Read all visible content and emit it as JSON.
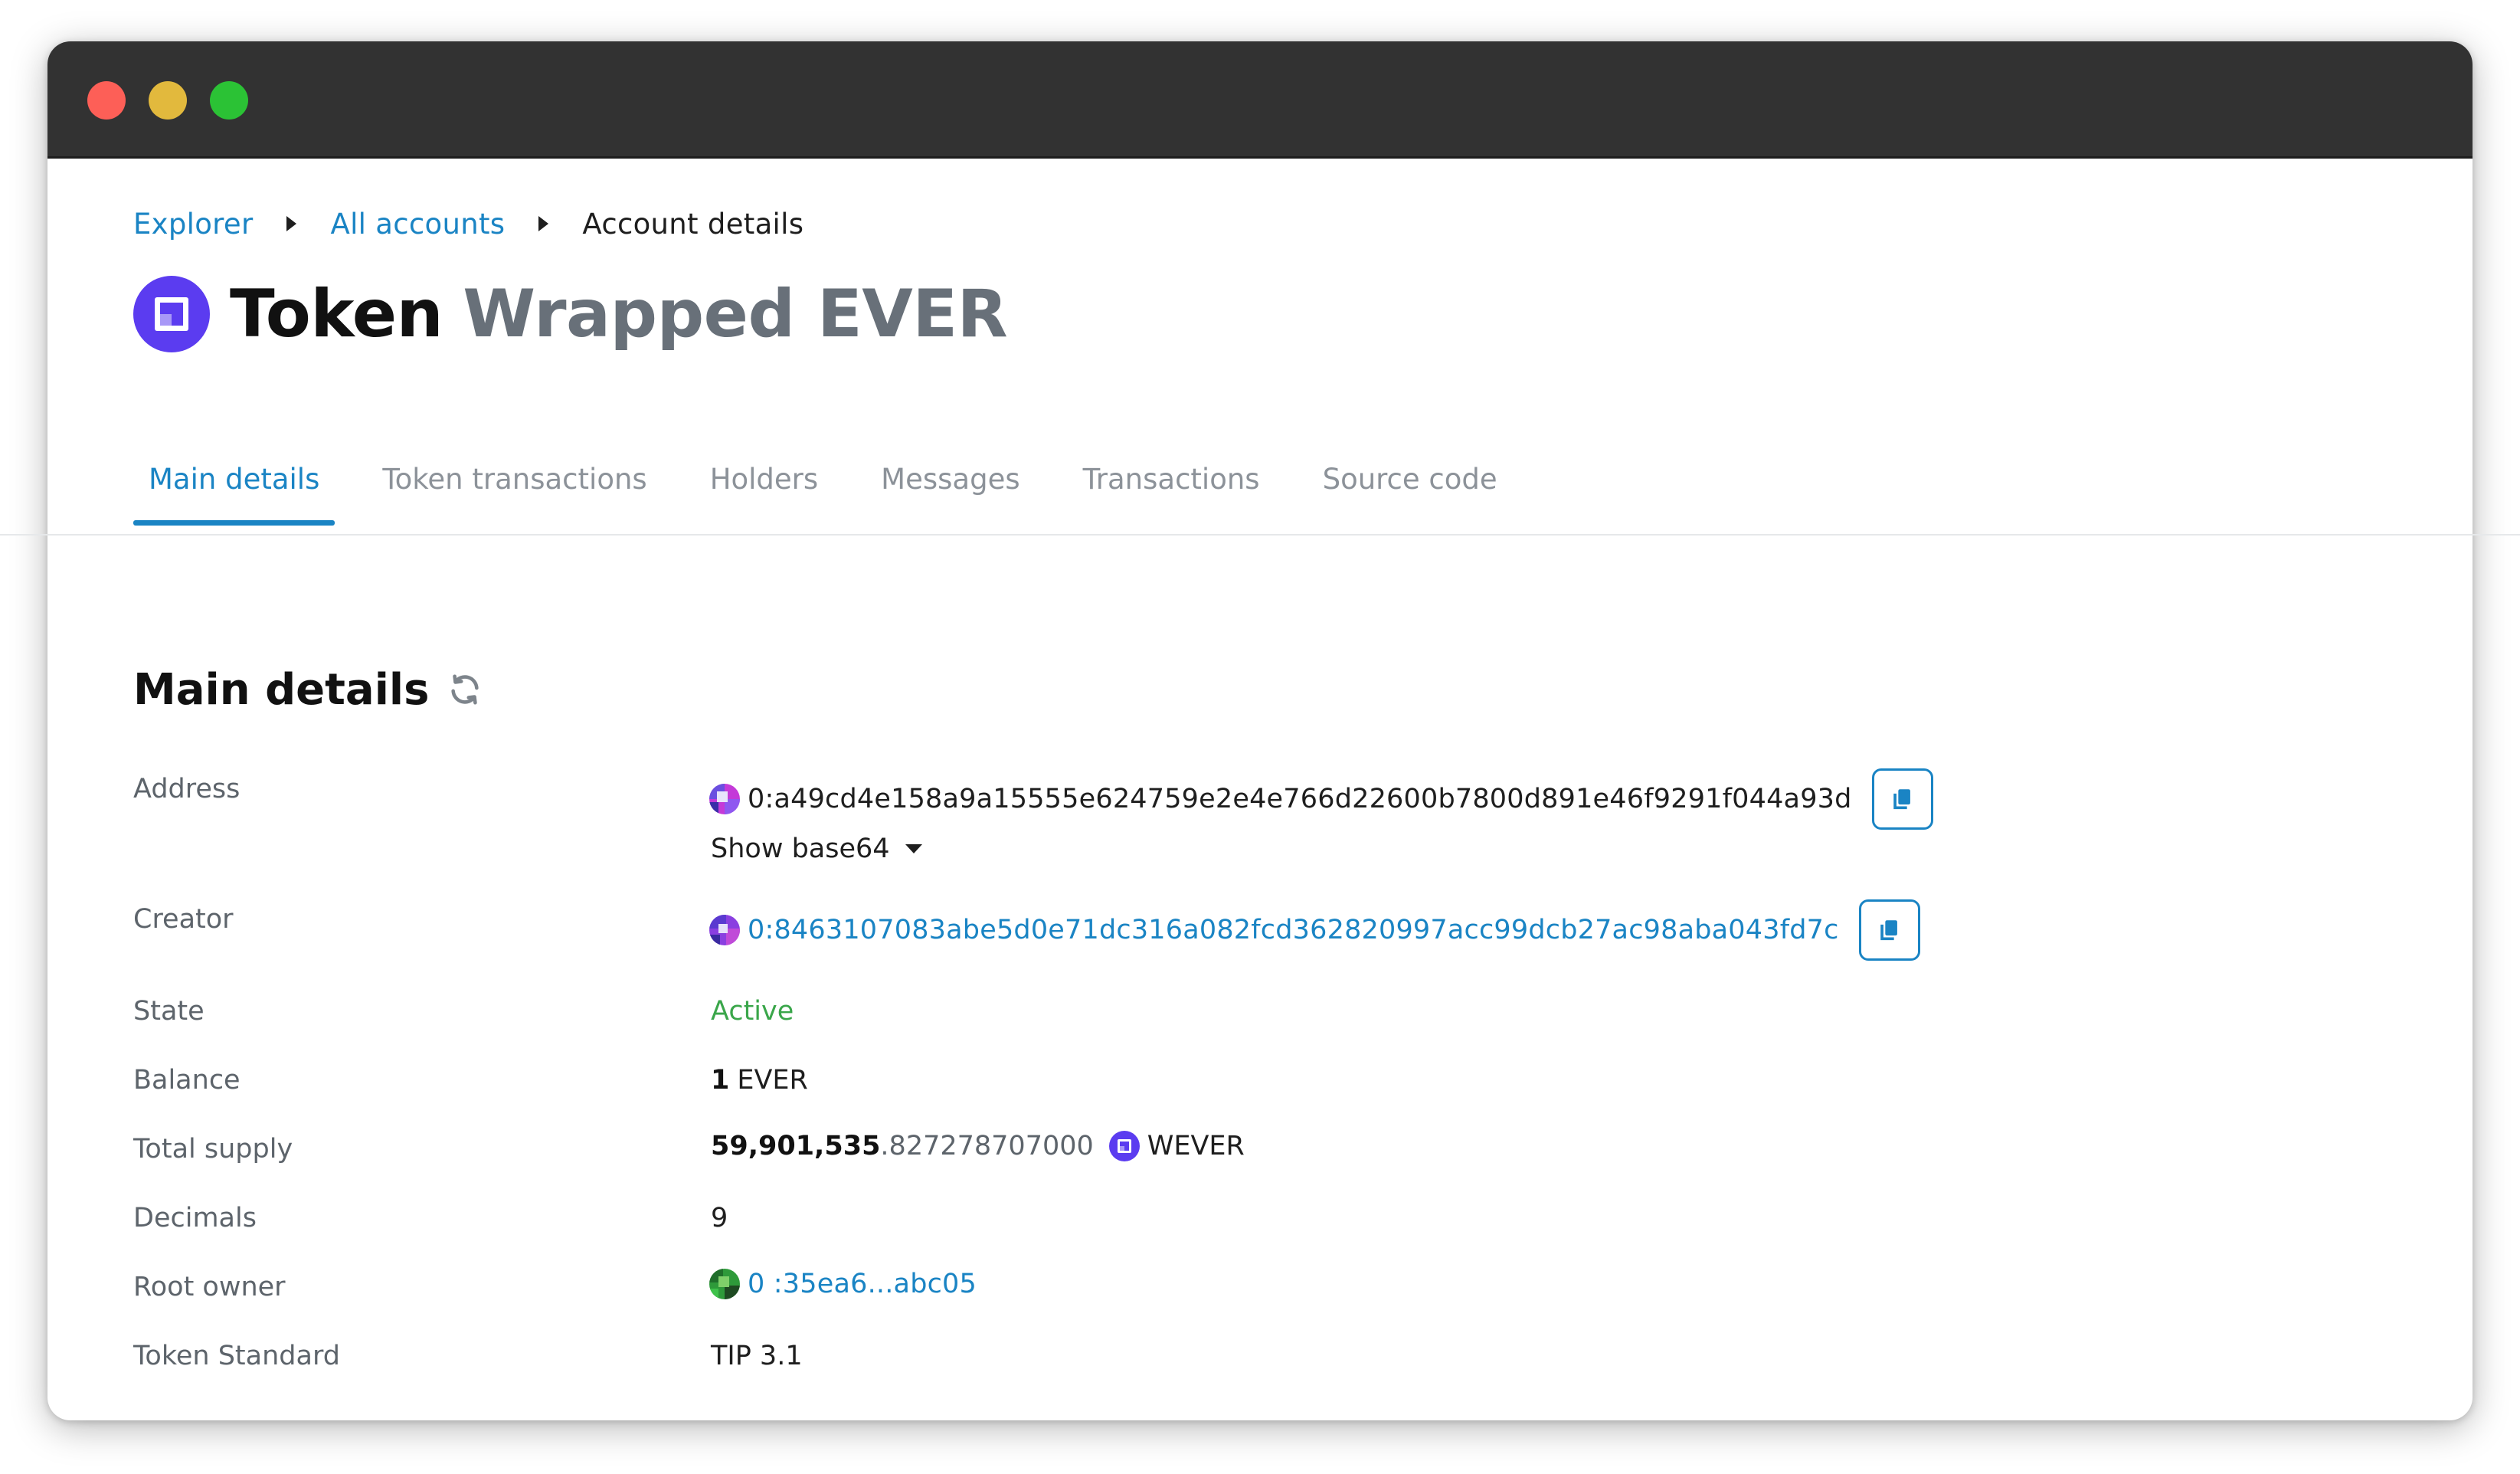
{
  "breadcrumb": {
    "explorer": "Explorer",
    "all_accounts": "All accounts",
    "current": "Account details"
  },
  "header": {
    "prefix": "Token",
    "name": "Wrapped EVER"
  },
  "tabs": [
    {
      "label": "Main details",
      "active": true
    },
    {
      "label": "Token transactions"
    },
    {
      "label": "Holders"
    },
    {
      "label": "Messages"
    },
    {
      "label": "Transactions"
    },
    {
      "label": "Source code"
    }
  ],
  "section": {
    "title": "Main details"
  },
  "details": {
    "address": {
      "label": "Address",
      "value": "0:a49cd4e158a9a15555e624759e2e4e766d22600b7800d891e46f9291f044a93d",
      "show_base64": "Show base64"
    },
    "creator": {
      "label": "Creator",
      "value": "0:8463107083abe5d0e71dc316a082fcd362820997acc99dcb27ac98aba043fd7c"
    },
    "state": {
      "label": "State",
      "value": "Active"
    },
    "balance": {
      "label": "Balance",
      "amount": "1",
      "currency": "EVER"
    },
    "total_supply": {
      "label": "Total supply",
      "integer": "59,901,535",
      "fraction": ".827278707000",
      "symbol": "WEVER"
    },
    "decimals": {
      "label": "Decimals",
      "value": "9"
    },
    "root_owner": {
      "label": "Root owner",
      "value": "0 :35ea6...abc05"
    },
    "token_standard": {
      "label": "Token Standard",
      "value": "TIP 3.1"
    }
  },
  "colors": {
    "accent": "#1a84c4",
    "active_state": "#3aa64a",
    "token_brand": "#5b3cf0",
    "titlebar": "#323232"
  },
  "icons": {
    "token_logo": "wrapped-ever-logo-icon",
    "refresh": "refresh-icon",
    "copy": "copy-icon",
    "address_avatar": "address-avatar-icon"
  }
}
